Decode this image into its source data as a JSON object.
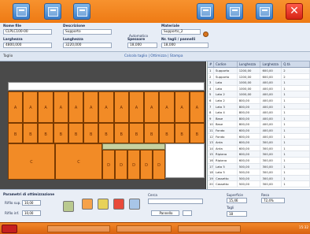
{
  "toolbar": {
    "buttons": [
      "home-icon",
      "save-icon",
      "monitor-icon",
      "panel-icon",
      "panel-icon",
      "panel-icon"
    ],
    "close_label": "✕"
  },
  "header": {
    "fields": [
      {
        "label": "Nome file",
        "value": "CLPLC100-00"
      },
      {
        "label": "Descrizione",
        "value": "Supporto"
      },
      {
        "label": "Materiale",
        "value": "Supporto_2"
      },
      {
        "label": "Larghezza",
        "value": "4800,000"
      },
      {
        "label": "Lunghezza",
        "value": "3220,000"
      },
      {
        "label": "Spessore",
        "value": "18,000"
      },
      {
        "label": "Nr. tagli / pannelli",
        "value": "18,000"
      }
    ],
    "automatic_label": "Automatico"
  },
  "subbar": {
    "left": "Taglio",
    "links": "Calcola taglio  |  Ottimizza  |  Stampa"
  },
  "tiles": {
    "row1": [
      "A",
      "A",
      "A",
      "A",
      "A",
      "A",
      "A",
      "A",
      "A",
      "A",
      "A",
      "A",
      "A"
    ],
    "row2": [
      "B",
      "B",
      "B",
      "B",
      "B",
      "B",
      "B",
      "B",
      "B",
      "B",
      "B",
      "B",
      "B"
    ],
    "row3_big": [
      "C",
      "C",
      "C"
    ],
    "row3_small": [
      "D",
      "D",
      "D",
      "D",
      "D"
    ]
  },
  "table": {
    "headers": [
      "#",
      "Codice",
      "Lunghezza",
      "Larghezza",
      "Q.tà"
    ],
    "rows": [
      [
        "1",
        "Supporto",
        "1200,00",
        "600,00",
        "2"
      ],
      [
        "2",
        "Supporto",
        "1200,00",
        "600,00",
        "2"
      ],
      [
        "3",
        "Lato",
        "1000,00",
        "400,00",
        "1"
      ],
      [
        "4",
        "Lato",
        "1000,00",
        "400,00",
        "1"
      ],
      [
        "5",
        "Lato 2",
        "1000,00",
        "400,00",
        "1"
      ],
      [
        "6",
        "Lato 2",
        "800,00",
        "400,00",
        "1"
      ],
      [
        "7",
        "Lato 3",
        "800,00",
        "400,00",
        "1"
      ],
      [
        "8",
        "Lato 4",
        "800,00",
        "400,00",
        "1"
      ],
      [
        "9",
        "Base",
        "800,00",
        "400,00",
        "1"
      ],
      [
        "10",
        "Base",
        "800,00",
        "400,00",
        "1"
      ],
      [
        "11",
        "Fondo",
        "600,00",
        "400,00",
        "1"
      ],
      [
        "12",
        "Fondo",
        "600,00",
        "400,00",
        "1"
      ],
      [
        "13",
        "Anta",
        "600,00",
        "300,00",
        "1"
      ],
      [
        "14",
        "Anta",
        "600,00",
        "300,00",
        "1"
      ],
      [
        "15",
        "Ripiano",
        "600,00",
        "300,00",
        "1"
      ],
      [
        "16",
        "Ripiano",
        "600,00",
        "300,00",
        "1"
      ],
      [
        "17",
        "Lato 5",
        "500,00",
        "300,00",
        "1"
      ],
      [
        "18",
        "Lato 5",
        "500,00",
        "300,00",
        "1"
      ],
      [
        "19",
        "Cassetto",
        "500,00",
        "300,00",
        "1"
      ],
      [
        "20",
        "Cassetto",
        "500,00",
        "300,00",
        "1"
      ]
    ]
  },
  "bottom": {
    "section_label": "Parametri di ottimizzazione",
    "field1_label": "Rifilo sup.",
    "field1_value": "10,00",
    "field2_label": "Rifilo inf.",
    "field2_value": "10,00",
    "search_label": "Cerca",
    "search_value": "",
    "select_value": "Pannello",
    "stat1_label": "Superficie",
    "stat1_value": "15,46",
    "stat2_label": "Resa",
    "stat2_value": "72,4%",
    "stat3_label": "Tagli",
    "stat3_value": "18"
  },
  "taskbar": {
    "clock": "15:32"
  }
}
